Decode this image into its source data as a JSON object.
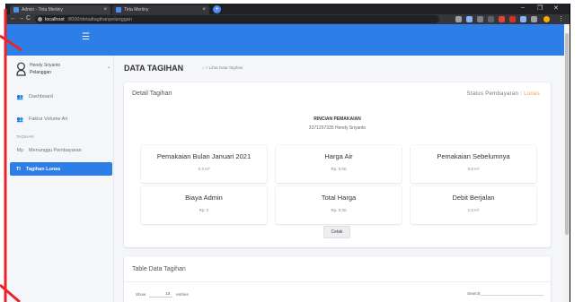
{
  "browser": {
    "tabs": [
      {
        "title": "Admin - Tirta Meriiny"
      },
      {
        "title": "Tirta Meriiny"
      }
    ],
    "new_tab": "+",
    "window_controls": [
      "–",
      "❐",
      "✕"
    ],
    "nav": {
      "back": "←",
      "forward": "→",
      "reload": "C"
    },
    "url_host": "localhost",
    "url_path": ":8000/detailtagihanpelanggan"
  },
  "app": {
    "menu_icon": "☰",
    "brand_color": "#2d7ee6",
    "status_color": "#e0a83b"
  },
  "sidebar": {
    "user_name": "Hendy Sriyanto",
    "user_role": "Pelanggan",
    "user_caret": "⌄",
    "items": [
      {
        "icon": "users-icon",
        "label": "Dashboard"
      },
      {
        "icon": "users-icon",
        "label": "Faktur Volume Air"
      }
    ],
    "section_header": "TAGIHAN",
    "section_items": [
      {
        "icon_text": "Mp",
        "label": "Menunggu Pembayaran"
      },
      {
        "icon_text": "Tl",
        "label": "Tagihan Lunas"
      }
    ]
  },
  "main": {
    "page_title": "DATA TAGIHAN",
    "breadcrumb_icon": "⌂",
    "breadcrumb_sep": ">",
    "breadcrumb": "Lihat Data Tagihan",
    "detail_card": {
      "title": "Detail Tagihan",
      "status_prefix": "Status Pembayaran : ",
      "status_value": "Lunas",
      "heading": "RINCIAN PEMAKAIAN",
      "customer_id": "3371257335",
      "customer_name": "Hendy Sriyanto",
      "stats": [
        {
          "label": "Pemakaian Bulan Januari 2021",
          "value": "0.3 m³"
        },
        {
          "label": "Harga Air",
          "value": "Rp. 0,00"
        },
        {
          "label": "Pemakaian Sebelumnya",
          "value": "0.6 m³"
        },
        {
          "label": "Biaya Admin",
          "value": "Rp. 0"
        },
        {
          "label": "Total Harga",
          "value": "Rp. 0,00"
        },
        {
          "label": "Debit Berjalan",
          "value": "1.0 m³"
        }
      ],
      "print_button": "Cetak"
    },
    "table_card": {
      "title": "Table Data Tagihan",
      "show_label": "Show",
      "entries_value": "10",
      "entries_label": "entries",
      "search_label": "Search:"
    }
  }
}
